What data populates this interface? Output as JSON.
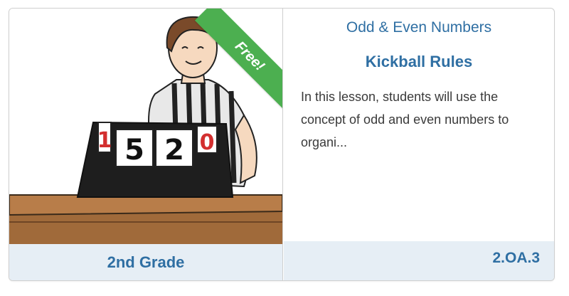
{
  "card": {
    "badge": "Free!",
    "grade": "2nd Grade",
    "topic": "Odd & Even Numbers",
    "title": "Kickball Rules",
    "description": "In this lesson, students will use the concept of odd and even numbers to organi...",
    "standard": "2.OA.3",
    "scoreboard_digits": [
      "1",
      "5",
      "2",
      "0"
    ],
    "colors": {
      "accent_blue": "#2f6fa3",
      "badge_green": "#4caf50",
      "bar_bg": "#e6eef5"
    }
  }
}
